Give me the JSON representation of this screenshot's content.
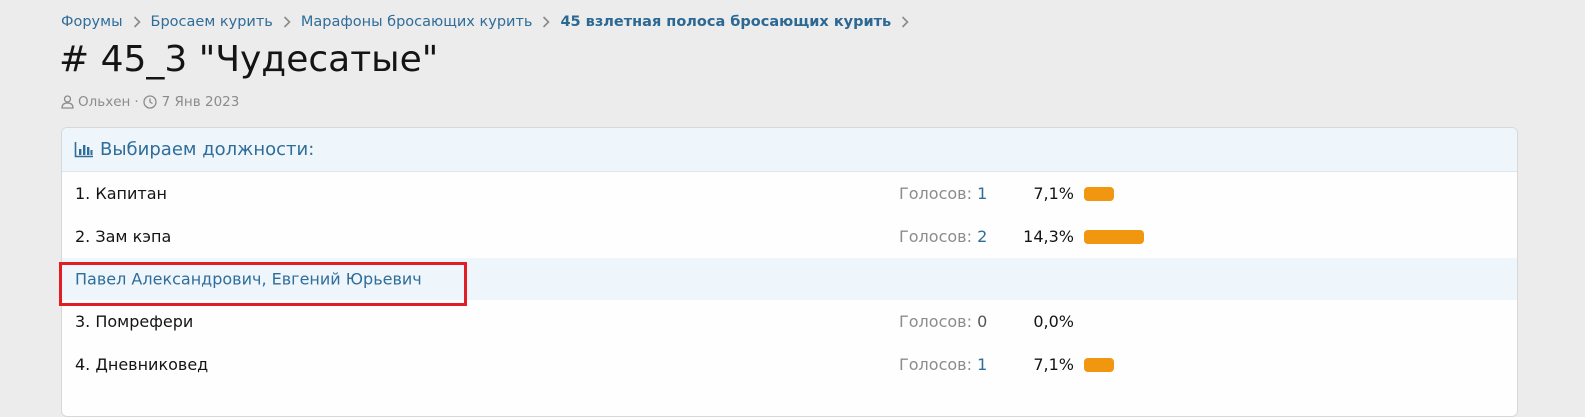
{
  "breadcrumb": {
    "items": [
      {
        "label": "Форумы"
      },
      {
        "label": "Бросаем курить"
      },
      {
        "label": "Марафоны бросающих курить"
      },
      {
        "label": "45 взлетная полоса бросающих курить"
      }
    ]
  },
  "thread": {
    "title": "# 45_3 \"Чудесатые\"",
    "author": "Ольхен",
    "separator": "·",
    "date": "7 Янв 2023"
  },
  "poll": {
    "question": "Выбираем должности:",
    "votes_label": "Голосов:",
    "options": [
      {
        "label": "1. Капитан",
        "votes": "1",
        "percent_text": "7,1%",
        "percent": 7.1
      },
      {
        "label": "2. Зам кэпа",
        "votes": "2",
        "percent_text": "14,3%",
        "percent": 14.3
      },
      {
        "label": "3. Помрефери",
        "votes": "0",
        "percent_text": "0,0%",
        "percent": 0.0
      },
      {
        "label": "4. Дневниковед",
        "votes": "1",
        "percent_text": "7,1%",
        "percent": 7.1
      }
    ],
    "voters_line": "Павел Александрович, Евгений Юрьевич"
  },
  "colors": {
    "link": "#2f6d9a",
    "bar": "#f0960f",
    "highlight": "#e01e24",
    "header_bg": "#eef5fb"
  }
}
